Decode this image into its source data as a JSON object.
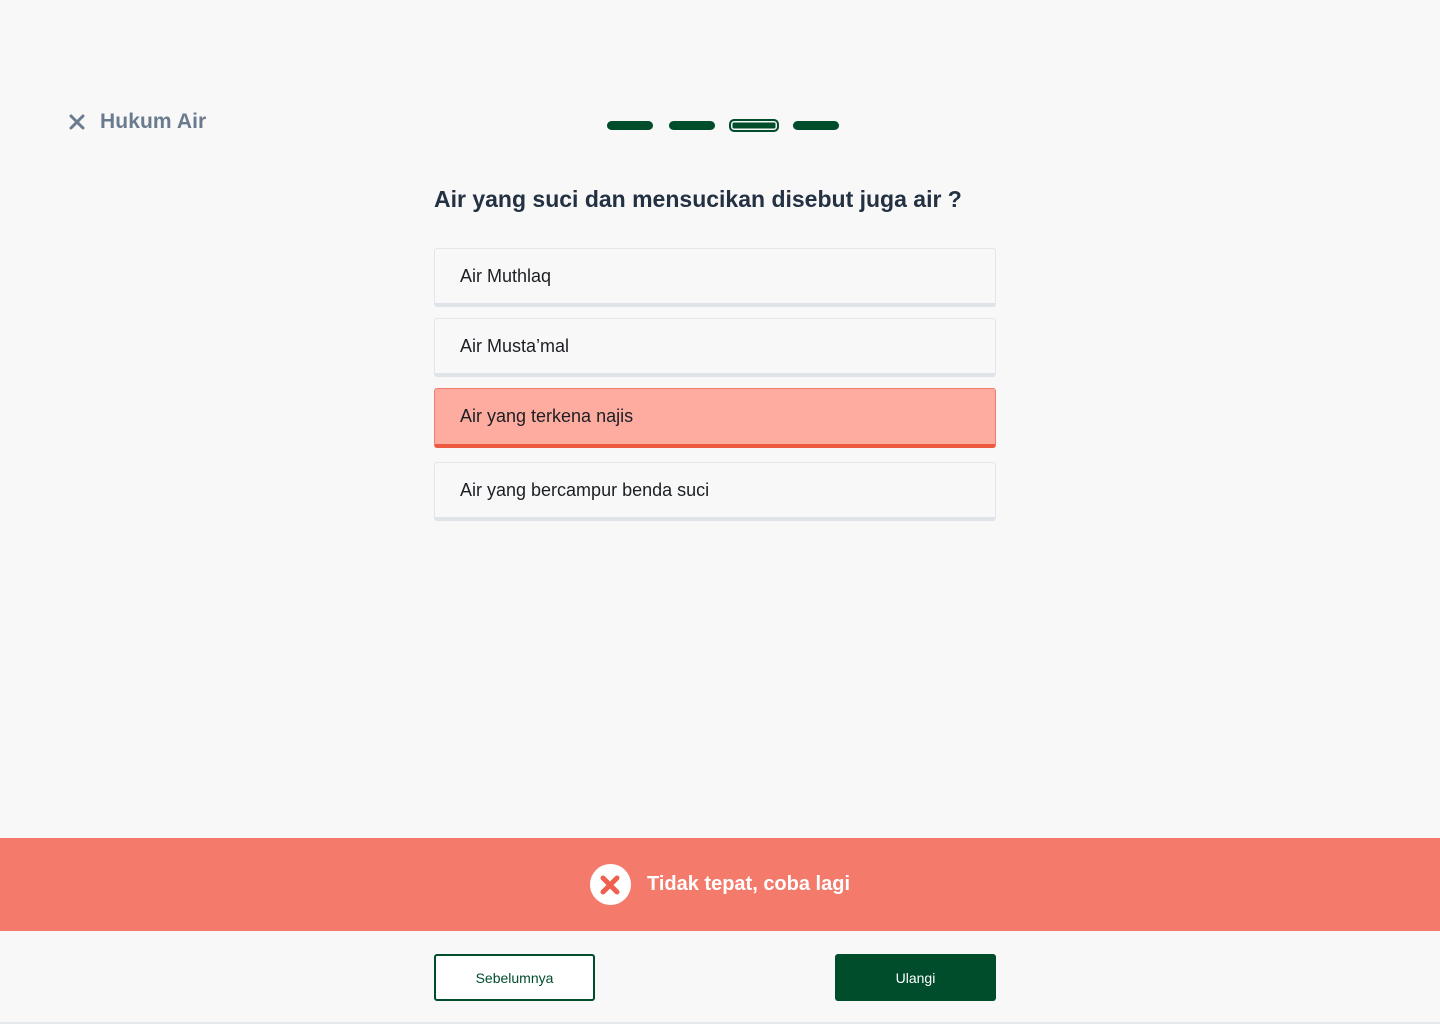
{
  "header": {
    "title": "Hukum Air",
    "close_icon": "close-icon"
  },
  "progress": {
    "total_steps": 4,
    "current_step": 3
  },
  "question": {
    "text": "Air yang suci dan mensucikan disebut juga air ?"
  },
  "options": [
    {
      "label": "Air Muthlaq",
      "state": "default"
    },
    {
      "label": "Air Musta’mal",
      "state": "default"
    },
    {
      "label": "Air yang terkena najis",
      "state": "wrong"
    },
    {
      "label": "Air yang bercampur benda suci",
      "state": "default"
    }
  ],
  "feedback": {
    "text": "Tidak tepat, coba lagi",
    "icon": "error-circle-icon",
    "color": "#f47b6c"
  },
  "nav": {
    "prev_label": "Sebelumnya",
    "retry_label": "Ulangi"
  },
  "colors": {
    "primary": "#004d2c",
    "wrong_bg": "#ffaca0",
    "wrong_border": "#ee5a3f"
  }
}
